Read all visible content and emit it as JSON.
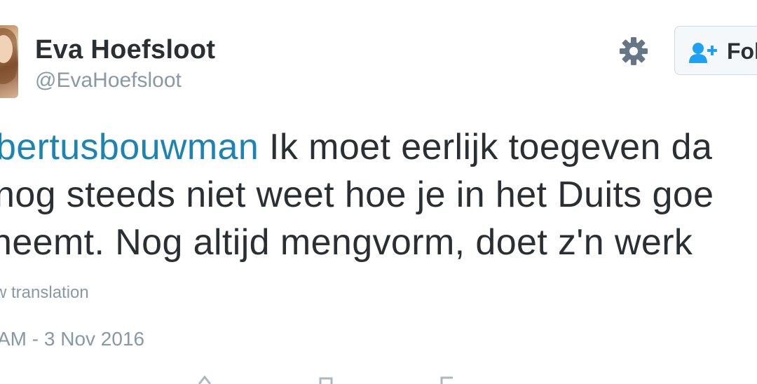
{
  "author": {
    "display_name": "Eva Hoefsloot",
    "handle": "@EvaHoefsloot"
  },
  "follow_button": {
    "label": "Fol",
    "icon": "user-plus-icon"
  },
  "settings_icon": "gear-icon",
  "tweet": {
    "line1": {
      "mention": "bertusbouwman",
      "text": " Ik moet eerlijk toegeven da"
    },
    "line2": "nog steeds niet weet hoe je in het Duits goe",
    "line3": "neemt. Nog altijd mengvorm, doet z'n werk"
  },
  "translation_link": "w translation",
  "timestamp": "AM - 3 Nov 2016",
  "colors": {
    "text": "#292f33",
    "secondary": "#8899a6",
    "link": "#1b84b3",
    "follow_icon": "#1da1f2"
  }
}
